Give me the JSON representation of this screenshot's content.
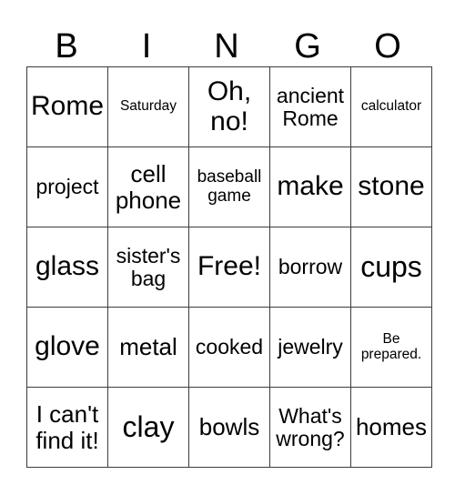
{
  "header": {
    "letters": [
      "B",
      "I",
      "N",
      "G",
      "O"
    ]
  },
  "board": {
    "rows": [
      [
        "Rome",
        "Saturday",
        "Oh, no!",
        "ancient Rome",
        "calculator"
      ],
      [
        "project",
        "cell phone",
        "baseball game",
        "make",
        "stone"
      ],
      [
        "glass",
        "sister's bag",
        "Free!",
        "borrow",
        "cups"
      ],
      [
        "glove",
        "metal",
        "cooked",
        "jewelry",
        "Be prepared."
      ],
      [
        "I can't find it!",
        "clay",
        "bowls",
        "What's wrong?",
        "homes"
      ]
    ]
  }
}
